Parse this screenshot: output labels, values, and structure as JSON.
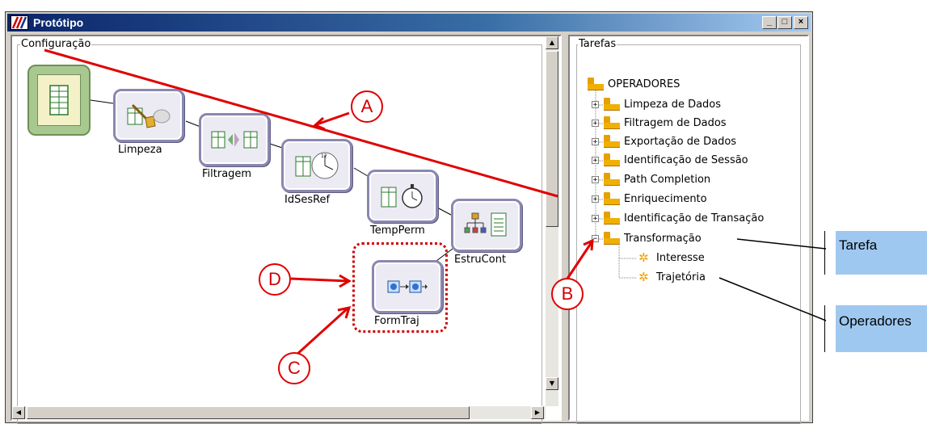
{
  "window": {
    "title": "Protótipo",
    "minimize_glyph": "_",
    "maximize_glyph": "□",
    "close_glyph": "×"
  },
  "config_panel": {
    "label": "Configuração",
    "nodes": [
      {
        "id": "source",
        "label": ""
      },
      {
        "id": "limpeza",
        "label": "Limpeza"
      },
      {
        "id": "filtragem",
        "label": "Filtragem"
      },
      {
        "id": "idsesref",
        "label": "IdSesRef"
      },
      {
        "id": "tempperm",
        "label": "TempPerm"
      },
      {
        "id": "estrucont",
        "label": "EstruCont"
      },
      {
        "id": "formtraj",
        "label": "FormTraj"
      }
    ]
  },
  "tasks_panel": {
    "label": "Tarefas",
    "root": "OPERADORES",
    "items": [
      {
        "label": "Limpeza de Dados",
        "expander": "+"
      },
      {
        "label": "Filtragem de Dados",
        "expander": "+"
      },
      {
        "label": "Exportação de Dados",
        "expander": "+"
      },
      {
        "label": "Identificação de Sessão",
        "expander": "+"
      },
      {
        "label": "Path Completion",
        "expander": "+"
      },
      {
        "label": "Enriquecimento",
        "expander": "+"
      },
      {
        "label": "Identificação de Transação",
        "expander": "+"
      },
      {
        "label": "Transformação",
        "expander": "−"
      }
    ],
    "children": [
      {
        "label": "Interesse"
      },
      {
        "label": "Trajetória"
      }
    ]
  },
  "annotations": {
    "markers": [
      "A",
      "B",
      "C",
      "D"
    ],
    "callouts": {
      "tarefa": "Tarefa",
      "operadores": "Operadores"
    },
    "color": "#e00000",
    "callout_color": "#9ec8f0"
  }
}
